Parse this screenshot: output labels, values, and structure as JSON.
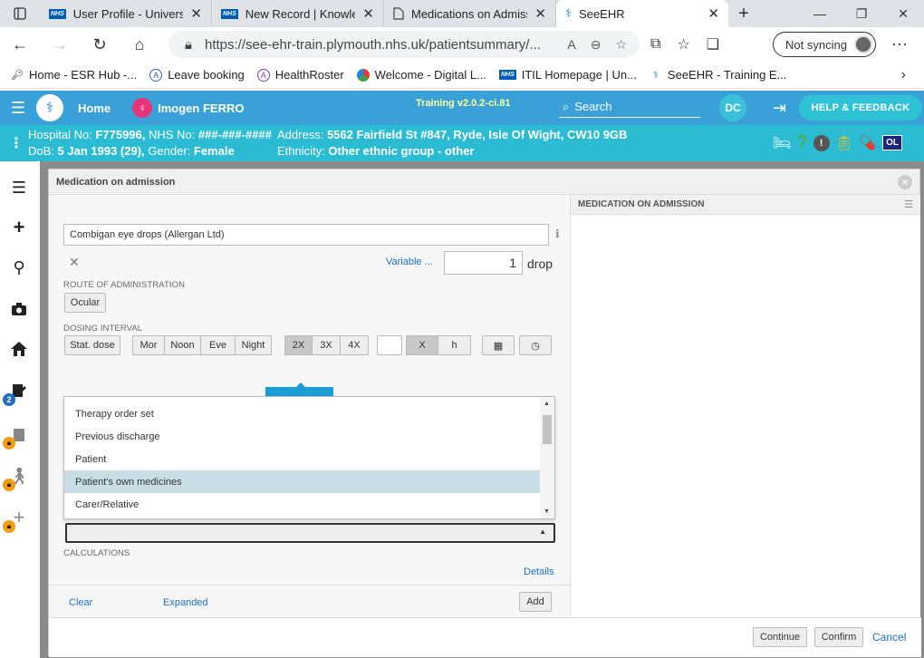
{
  "browser": {
    "tabs": [
      {
        "title": "User Profile - University",
        "icon": "nhs"
      },
      {
        "title": "New Record | Knowledg",
        "icon": "nhs"
      },
      {
        "title": "Medications on Admiss",
        "icon": "page"
      },
      {
        "title": "SeeEHR",
        "icon": "seeehr",
        "active": true
      }
    ],
    "url": "https://see-ehr-train.plymouth.nhs.uk/patientsummary/...",
    "sync_label": "Not syncing",
    "bookmarks": [
      {
        "label": "Home - ESR Hub -...",
        "icon": "esr"
      },
      {
        "label": "Leave booking",
        "icon": "leave"
      },
      {
        "label": "HealthRoster",
        "icon": "healthroster"
      },
      {
        "label": "Welcome - Digital L...",
        "icon": "digital"
      },
      {
        "label": "ITIL Homepage | Un...",
        "icon": "nhs"
      },
      {
        "label": "SeeEHR - Training E...",
        "icon": "seeehr"
      }
    ]
  },
  "app": {
    "home_label": "Home",
    "patient_name": "Imogen FERRO",
    "training_label": "Training v2.0.2-ci.81",
    "search_label": "Search",
    "user_initials": "DC",
    "help_label": "HELP & FEEDBACK",
    "accent": "#3aa0d8"
  },
  "banner": {
    "hospital_no_label": "Hospital No:",
    "hospital_no": "F775996,",
    "nhs_no_label": "NHS No:",
    "nhs_no": "###-###-####",
    "dob_label": "DoB:",
    "dob": "5 Jan 1993 (29),",
    "gender_label": "Gender:",
    "gender": "Female",
    "address_label": "Address:",
    "address": "5562 Fairfield St #847, Ryde, Isle Of Wight, CW10 9GB",
    "ethnicity_label": "Ethnicity:",
    "ethnicity": "Other ethnic group - other",
    "badge": "OL"
  },
  "sidebar": {
    "badge_count": "2"
  },
  "modal": {
    "title": "Medication on admission",
    "right_title": "MEDICATION ON ADMISSION",
    "drug": "Combigan eye drops (Allergan Ltd)",
    "variable_label": "Variable ...",
    "dose_value": "1",
    "dose_unit": "drop",
    "route_label": "ROUTE OF ADMINISTRATION",
    "route_value": "Ocular",
    "dosing_label": "DOSING INTERVAL",
    "stat_dose": "Stat. dose",
    "times": [
      "Mor",
      "Noon",
      "Eve",
      "Night"
    ],
    "freq": [
      "2X",
      "3X",
      "4X"
    ],
    "x_label": "X",
    "h_label": "h",
    "source_options": [
      "Therapy order set",
      "Previous discharge",
      "Patient",
      "Patient's own medicines",
      "Carer/Relative"
    ],
    "source_selected": "Patient's own medicines",
    "calculations_label": "CALCULATIONS",
    "details_label": "Details",
    "clear_label": "Clear",
    "expanded_label": "Expanded",
    "add_label": "Add",
    "continue_label": "Continue",
    "confirm_label": "Confirm",
    "cancel_label": "Cancel"
  }
}
